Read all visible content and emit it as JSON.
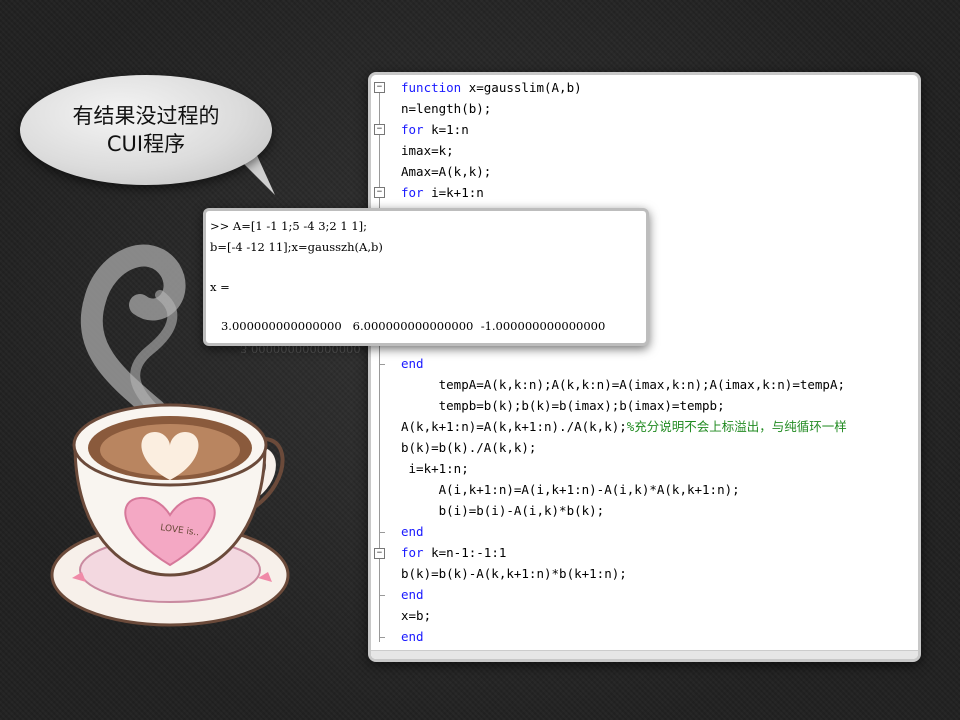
{
  "bubble": {
    "line1": "有结果没过程的",
    "line2": "CUI程序"
  },
  "editor": {
    "lines": [
      {
        "parts": [
          {
            "t": "function ",
            "k": "kw"
          },
          {
            "t": "x=gausslim(A,b)",
            "k": ""
          }
        ]
      },
      {
        "parts": [
          {
            "t": "n=length(b);",
            "k": ""
          }
        ]
      },
      {
        "parts": [
          {
            "t": "for ",
            "k": "kw"
          },
          {
            "t": "k=1:n",
            "k": ""
          }
        ]
      },
      {
        "parts": [
          {
            "t": "imax=k;",
            "k": ""
          }
        ]
      },
      {
        "parts": [
          {
            "t": "Amax=A(k,k);",
            "k": ""
          }
        ]
      },
      {
        "parts": [
          {
            "t": "for ",
            "k": "kw"
          },
          {
            "t": "i=k+1:n",
            "k": ""
          }
        ]
      },
      {
        "parts": [
          {
            "t": "end",
            "k": "kw"
          }
        ]
      },
      {
        "parts": [
          {
            "t": "     tempA=A(k,k:n);A(k,k:n)=A(imax,k:n);A(imax,k:n)=tempA;",
            "k": ""
          }
        ]
      },
      {
        "parts": [
          {
            "t": "     tempb=b(k);b(k)=b(imax);b(imax)=tempb;",
            "k": ""
          }
        ]
      },
      {
        "parts": [
          {
            "t": "A(k,k+1:n)=A(k,k+1:n)./A(k,k);",
            "k": ""
          },
          {
            "t": "%充分说明不会上标溢出，与纯循环一样",
            "k": "cm"
          }
        ]
      },
      {
        "parts": [
          {
            "t": "b(k)=b(k)./A(k,k);",
            "k": ""
          }
        ]
      },
      {
        "parts": [
          {
            "t": " i=k+1:n;",
            "k": ""
          }
        ]
      },
      {
        "parts": [
          {
            "t": "     A(i,k+1:n)=A(i,k+1:n)-A(i,k)*A(k,k+1:n);",
            "k": ""
          }
        ]
      },
      {
        "parts": [
          {
            "t": "     b(i)=b(i)-A(i,k)*b(k);",
            "k": ""
          }
        ]
      },
      {
        "parts": [
          {
            "t": "end",
            "k": "kw"
          }
        ]
      },
      {
        "parts": [
          {
            "t": "for ",
            "k": "kw"
          },
          {
            "t": "k=n-1:-1:1",
            "k": ""
          }
        ]
      },
      {
        "parts": [
          {
            "t": "b(k)=b(k)-A(k,k+1:n)*b(k+1:n);",
            "k": ""
          }
        ]
      },
      {
        "parts": [
          {
            "t": "end",
            "k": "kw"
          }
        ]
      },
      {
        "parts": [
          {
            "t": "x=b;",
            "k": ""
          }
        ]
      },
      {
        "parts": [
          {
            "t": "end",
            "k": "kw"
          }
        ]
      }
    ]
  },
  "cmd": {
    "line1": ">> A=[1 -1 1;5 -4 3;2 1 1];",
    "line2": "b=[-4 -12 11];x=gausszh(A,b)",
    "line3": "x =",
    "line4": "   3.000000000000000   6.000000000000000  -1.000000000000000"
  },
  "cup": {
    "label": "LOVE is.."
  },
  "colors": {
    "keyword": "#1a1aff",
    "comment": "#228b22",
    "background": "#2a2a2a",
    "heart": "#f4a8c4"
  }
}
